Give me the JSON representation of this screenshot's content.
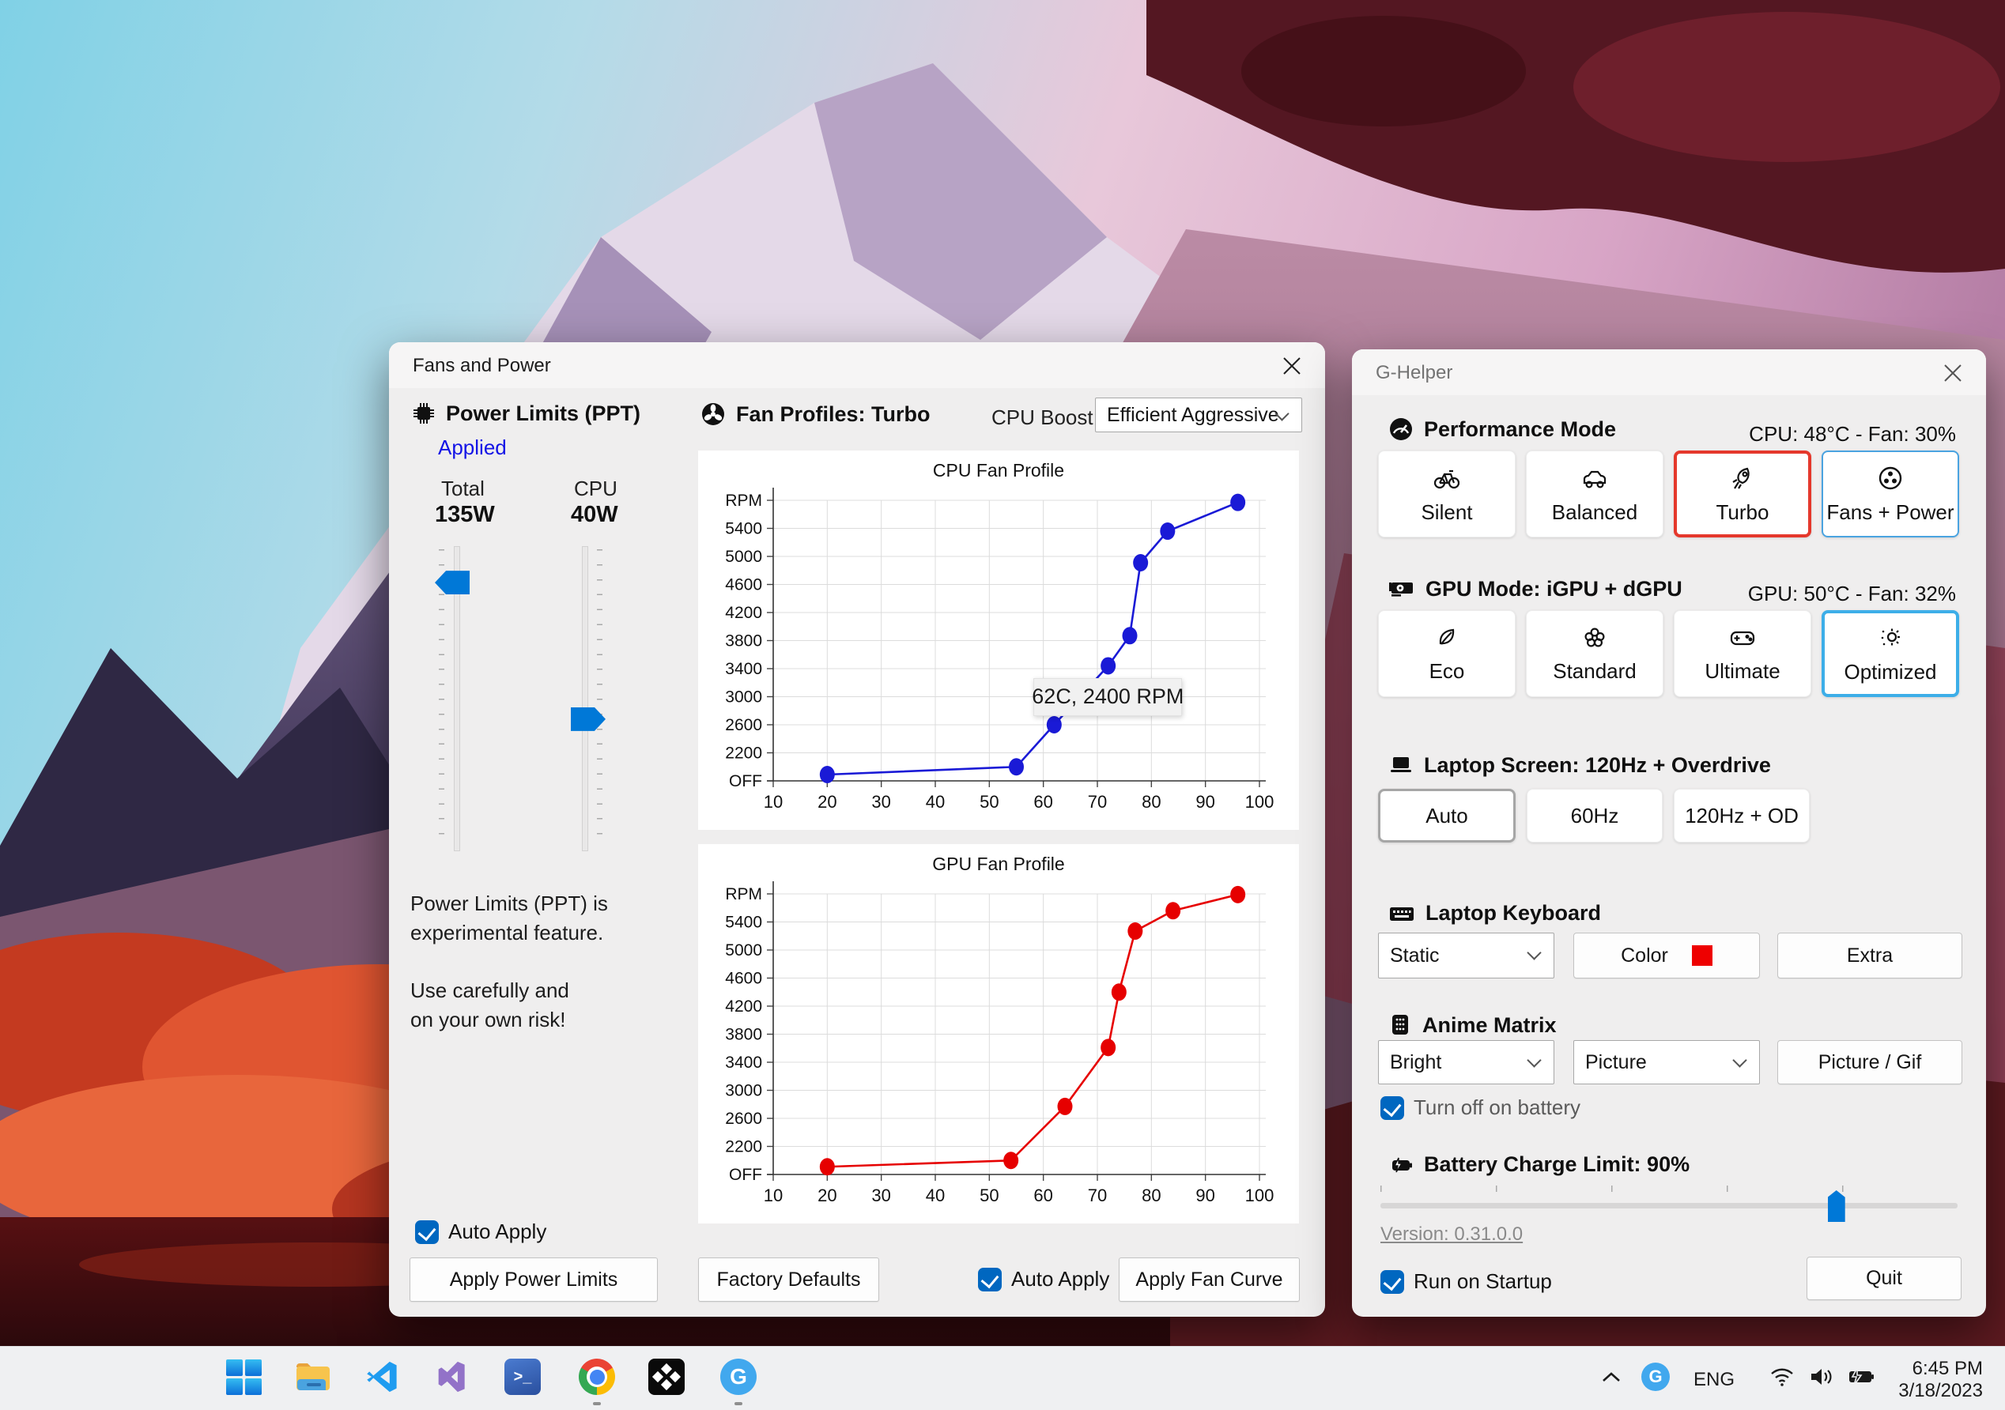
{
  "colors": {
    "accent_blue": "#0078d7",
    "checkbox_blue": "#0067c0",
    "turbo_selected_red": "#e5382c",
    "optimized_selected_blue": "#3daee8",
    "cpu_line": "#1a1ad6",
    "gpu_line": "#e60000",
    "applied_link_blue": "#1414e6",
    "keyboard_color_swatch": "#ee0000"
  },
  "fans_window": {
    "title": "Fans and Power",
    "power_limits": {
      "heading": "Power Limits (PPT)",
      "status": "Applied",
      "total_label": "Total",
      "total_value": "135W",
      "cpu_label": "CPU",
      "cpu_value": "40W",
      "total_slider_pct": 12,
      "cpu_slider_pct": 57,
      "note_line1": "Power Limits (PPT) is",
      "note_line2": "experimental feature.",
      "note_line3": "Use carefully and",
      "note_line4": "on your own risk!",
      "auto_apply": "Auto Apply",
      "apply_button": "Apply Power Limits"
    },
    "fan_profiles": {
      "heading": "Fan Profiles: Turbo",
      "cpu_boost_label": "CPU Boost",
      "cpu_boost_value": "Efficient Aggressive",
      "factory_defaults": "Factory Defaults",
      "auto_apply": "Auto Apply",
      "apply_button": "Apply Fan Curve"
    }
  },
  "chart_data": [
    {
      "type": "line",
      "title": "CPU Fan Profile",
      "series": [
        {
          "name": "CPU fan curve",
          "points": [
            [
              20,
              1890
            ],
            [
              55,
              2000
            ],
            [
              62,
              2600
            ],
            [
              72,
              3440
            ],
            [
              76,
              3870
            ],
            [
              78,
              4910
            ],
            [
              83,
              5360
            ],
            [
              96,
              5770
            ]
          ]
        }
      ],
      "color": "#1a1ad6",
      "x_ticks": [
        10,
        20,
        30,
        40,
        50,
        60,
        70,
        80,
        90,
        100
      ],
      "y_tick_labels": [
        "OFF",
        "2200",
        "2600",
        "3000",
        "3400",
        "3800",
        "4200",
        "4600",
        "5000",
        "5400",
        "RPM"
      ],
      "y_scale_note": "OFF baseline = 1800 RPM equivalent, 400 RPM per gridline, RPM top = 5800",
      "xlim": [
        10,
        100
      ],
      "grid": true,
      "legend": "none",
      "tooltip": "62C, 2400 RPM",
      "tooltip_anchor": {
        "x": 62,
        "y": 3000
      }
    },
    {
      "type": "line",
      "title": "GPU Fan Profile",
      "series": [
        {
          "name": "GPU fan curve",
          "points": [
            [
              20,
              1910
            ],
            [
              54,
              2000
            ],
            [
              64,
              2770
            ],
            [
              72,
              3610
            ],
            [
              74,
              4400
            ],
            [
              77,
              5270
            ],
            [
              84,
              5560
            ],
            [
              96,
              5790
            ]
          ]
        }
      ],
      "color": "#e60000",
      "x_ticks": [
        10,
        20,
        30,
        40,
        50,
        60,
        70,
        80,
        90,
        100
      ],
      "y_tick_labels": [
        "OFF",
        "2200",
        "2600",
        "3000",
        "3400",
        "3800",
        "4200",
        "4600",
        "5000",
        "5400",
        "RPM"
      ],
      "y_scale_note": "OFF baseline = 1800 RPM equivalent, 400 RPM per gridline, RPM top = 5800",
      "xlim": [
        10,
        100
      ],
      "grid": true,
      "legend": "none"
    }
  ],
  "ghelper_window": {
    "title": "G-Helper",
    "performance": {
      "heading": "Performance Mode",
      "status": "CPU: 48°C -  Fan: 30%",
      "buttons": [
        {
          "label": "Silent",
          "icon": "bicycle-icon"
        },
        {
          "label": "Balanced",
          "icon": "car-icon"
        },
        {
          "label": "Turbo",
          "icon": "rocket-icon",
          "selected": true
        },
        {
          "label": "Fans + Power",
          "icon": "fan-icon",
          "outlined": true
        }
      ]
    },
    "gpu_mode": {
      "heading": "GPU Mode: iGPU + dGPU",
      "status": "GPU: 50°C -  Fan: 32%",
      "buttons": [
        {
          "label": "Eco",
          "icon": "leaf-icon"
        },
        {
          "label": "Standard",
          "icon": "flower-icon"
        },
        {
          "label": "Ultimate",
          "icon": "gamepad-icon"
        },
        {
          "label": "Optimized",
          "icon": "bulb-gear-icon",
          "selected": true
        }
      ]
    },
    "screen": {
      "heading": "Laptop Screen: 120Hz + Overdrive",
      "buttons": [
        {
          "label": "Auto",
          "selected": true
        },
        {
          "label": "60Hz"
        },
        {
          "label": "120Hz + OD"
        }
      ]
    },
    "keyboard": {
      "heading": "Laptop Keyboard",
      "mode_value": "Static",
      "color_button": "Color",
      "extra_button": "Extra"
    },
    "anime": {
      "heading": "Anime Matrix",
      "brightness_value": "Bright",
      "content_value": "Picture",
      "picture_button": "Picture / Gif",
      "battery_checkbox": "Turn off on battery",
      "battery_checked": true
    },
    "battery": {
      "heading": "Battery Charge Limit: 90%",
      "value_pct": 90,
      "slider_fraction": 0.79
    },
    "version_link": "Version: 0.31.0.0",
    "startup_checkbox": "Run on Startup",
    "startup_checked": true,
    "quit_button": "Quit"
  },
  "taskbar": {
    "apps": [
      "start",
      "file-explorer",
      "vscode",
      "visual-studio",
      "powershell",
      "chrome",
      "tidal",
      "ghelper"
    ],
    "running_apps": [
      "chrome",
      "ghelper"
    ],
    "tray": {
      "language": "ENG",
      "time": "6:45 PM",
      "date": "3/18/2023"
    }
  }
}
